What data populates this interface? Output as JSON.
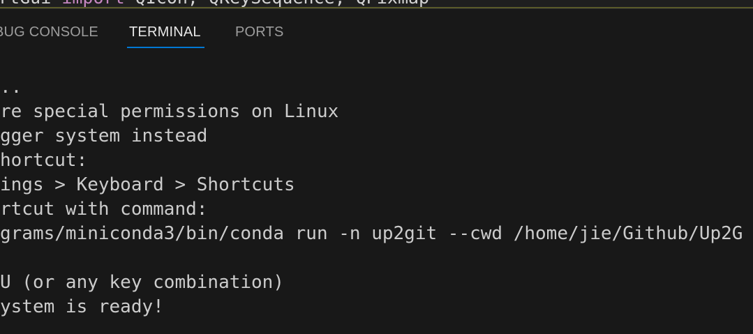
{
  "editor": {
    "partial_line": {
      "part1": "rtGui ",
      "keyword": "import",
      "part2": " QIcon, QKeySequence, QPixmap"
    }
  },
  "panel": {
    "tabs": [
      {
        "label": "BUG CONSOLE",
        "active": false
      },
      {
        "label": "TERMINAL",
        "active": true
      },
      {
        "label": "PORTS",
        "active": false
      }
    ],
    "accent_color": "#0078d4"
  },
  "terminal": {
    "lines": [
      "..",
      "re special permissions on Linux",
      "gger system instead",
      "hortcut:",
      "ings > Keyboard > Shortcuts",
      "rtcut with command:",
      "grams/miniconda3/bin/conda run -n up2git --cwd /home/jie/Github/Up2G",
      "",
      "U (or any key combination)",
      "ystem is ready!"
    ]
  }
}
